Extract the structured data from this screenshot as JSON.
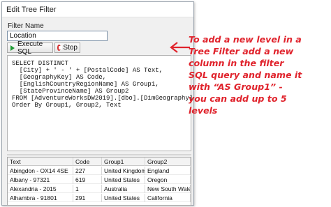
{
  "window": {
    "title": "Edit Tree Filter"
  },
  "filter": {
    "label": "Filter Name",
    "value": "Location"
  },
  "toolbar": {
    "execute_label": "Execute SQL",
    "stop_label": "Stop"
  },
  "sql": {
    "lines": [
      "SELECT DISTINCT",
      "  [City] + ' - ' + [PostalCode] AS Text,",
      "  [GeographyKey] AS Code,",
      "  [EnglishCountryRegionName] AS Group1,",
      "  [StateProvinceName] AS Group2",
      "FROM [AdventureWorksDW2019].[dbo].[DimGeography]",
      "Order By Group1, Group2, Text"
    ]
  },
  "grid": {
    "columns": [
      "Text",
      "Code",
      "Group1",
      "Group2"
    ],
    "rows": [
      [
        "Abingdon - OX14 4SE",
        "227",
        "United Kingdom",
        "England"
      ],
      [
        "Albany - 97321",
        "619",
        "United States",
        "Oregon"
      ],
      [
        "Alexandria - 2015",
        "1",
        "Australia",
        "New South Wales"
      ],
      [
        "Alhambra - 91801",
        "291",
        "United States",
        "California"
      ]
    ]
  },
  "callout": {
    "lines": [
      "To add a new level in a",
      "Tree Filter add a new",
      "column in the filter",
      "SQL query and name it",
      "with “AS Group1” -",
      "you can add up to 5",
      "levels"
    ]
  },
  "colors": {
    "callout": "#e0232c",
    "execute_icon": "#1f9b35",
    "stop_icon": "#d62d2d"
  }
}
